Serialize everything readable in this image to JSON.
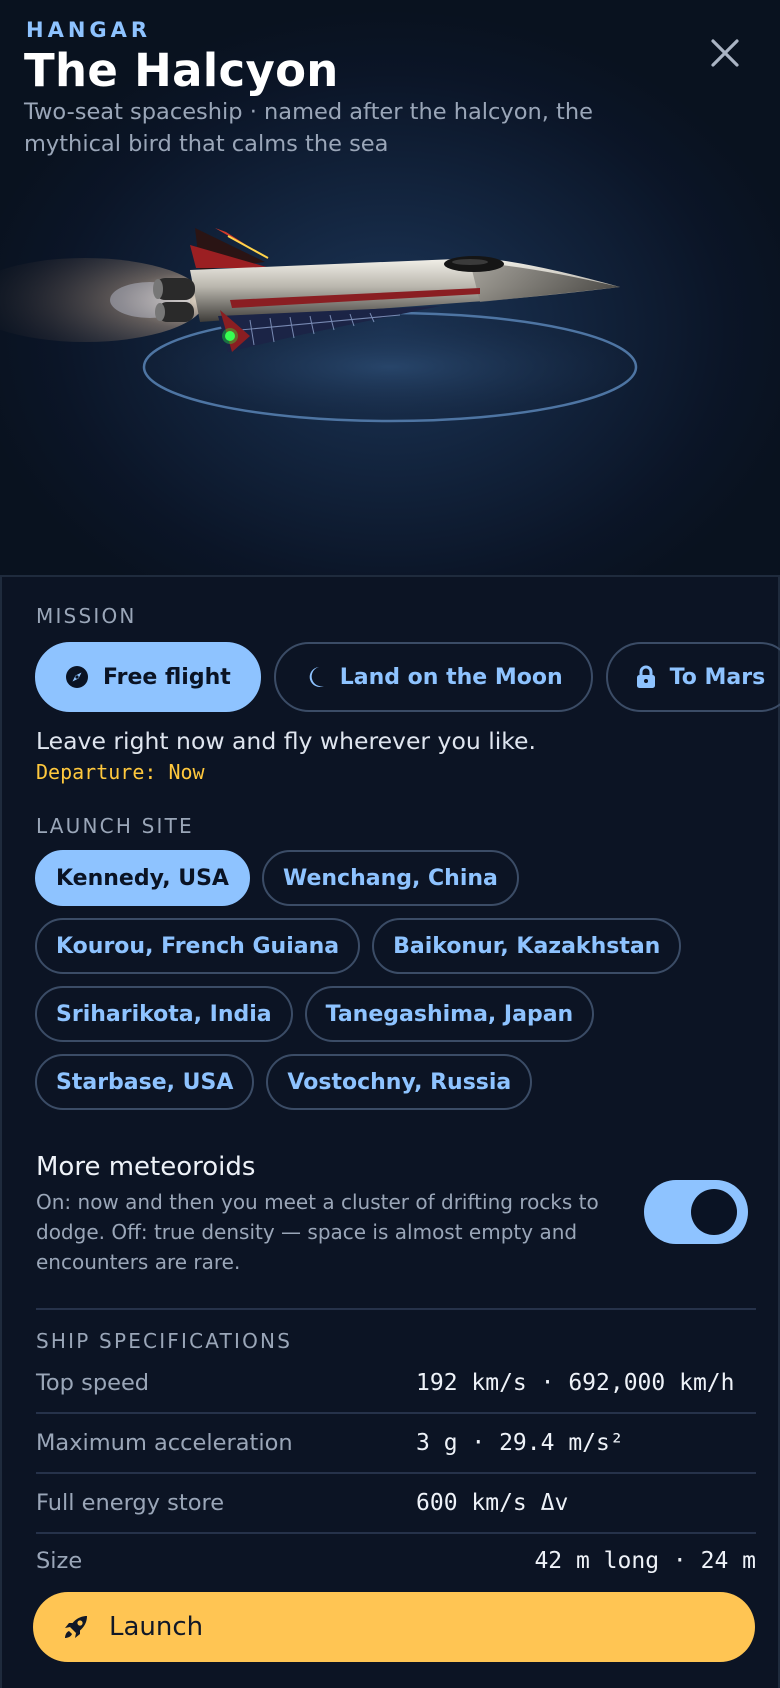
{
  "header": {
    "eyebrow": "HANGAR",
    "title": "The Halcyon",
    "subtitle": "Two-seat spaceship · named after the halcyon, the mythical bird that calms the sea",
    "close_icon": "close-icon"
  },
  "mission": {
    "label": "MISSION",
    "options": [
      {
        "label": "Free flight",
        "icon": "compass-icon",
        "active": true,
        "locked": false
      },
      {
        "label": "Land on the Moon",
        "icon": "moon-icon",
        "active": false,
        "locked": false
      },
      {
        "label": "To Mars",
        "icon": "lock-icon",
        "active": false,
        "locked": true
      },
      {
        "label": "",
        "icon": "lock-icon",
        "active": false,
        "locked": true
      }
    ],
    "description": "Leave right now and fly wherever you like.",
    "departure": "Departure: Now"
  },
  "launch_site": {
    "label": "LAUNCH SITE",
    "selected": "Kennedy, USA",
    "sites": [
      "Kennedy, USA",
      "Wenchang, China",
      "Kourou, French Guiana",
      "Baikonur, Kazakhstan",
      "Sriharikota, India",
      "Tanegashima, Japan",
      "Starbase, USA",
      "Vostochny, Russia"
    ]
  },
  "meteoroids": {
    "title": "More meteoroids",
    "description": "On: now and then you meet a cluster of drifting rocks to dodge. Off: true density — space is almost empty and encounters are rare.",
    "enabled": true
  },
  "specs": {
    "label": "SHIP SPECIFICATIONS",
    "rows": [
      {
        "label": "Top speed",
        "value": "192 km/s · 692,000 km/h"
      },
      {
        "label": "Maximum acceleration",
        "value": "3 g · 29.4 m/s²"
      },
      {
        "label": "Full energy store",
        "value": "600 km/s Δv"
      },
      {
        "label": "Size",
        "value": "42 m long · 24 m"
      }
    ]
  },
  "launch": {
    "label": "Launch",
    "icon": "rocket-icon"
  },
  "colors": {
    "accent": "#8ec3ff",
    "launch": "#ffc553",
    "departure": "#ffc83d",
    "background": "#0c1424"
  }
}
